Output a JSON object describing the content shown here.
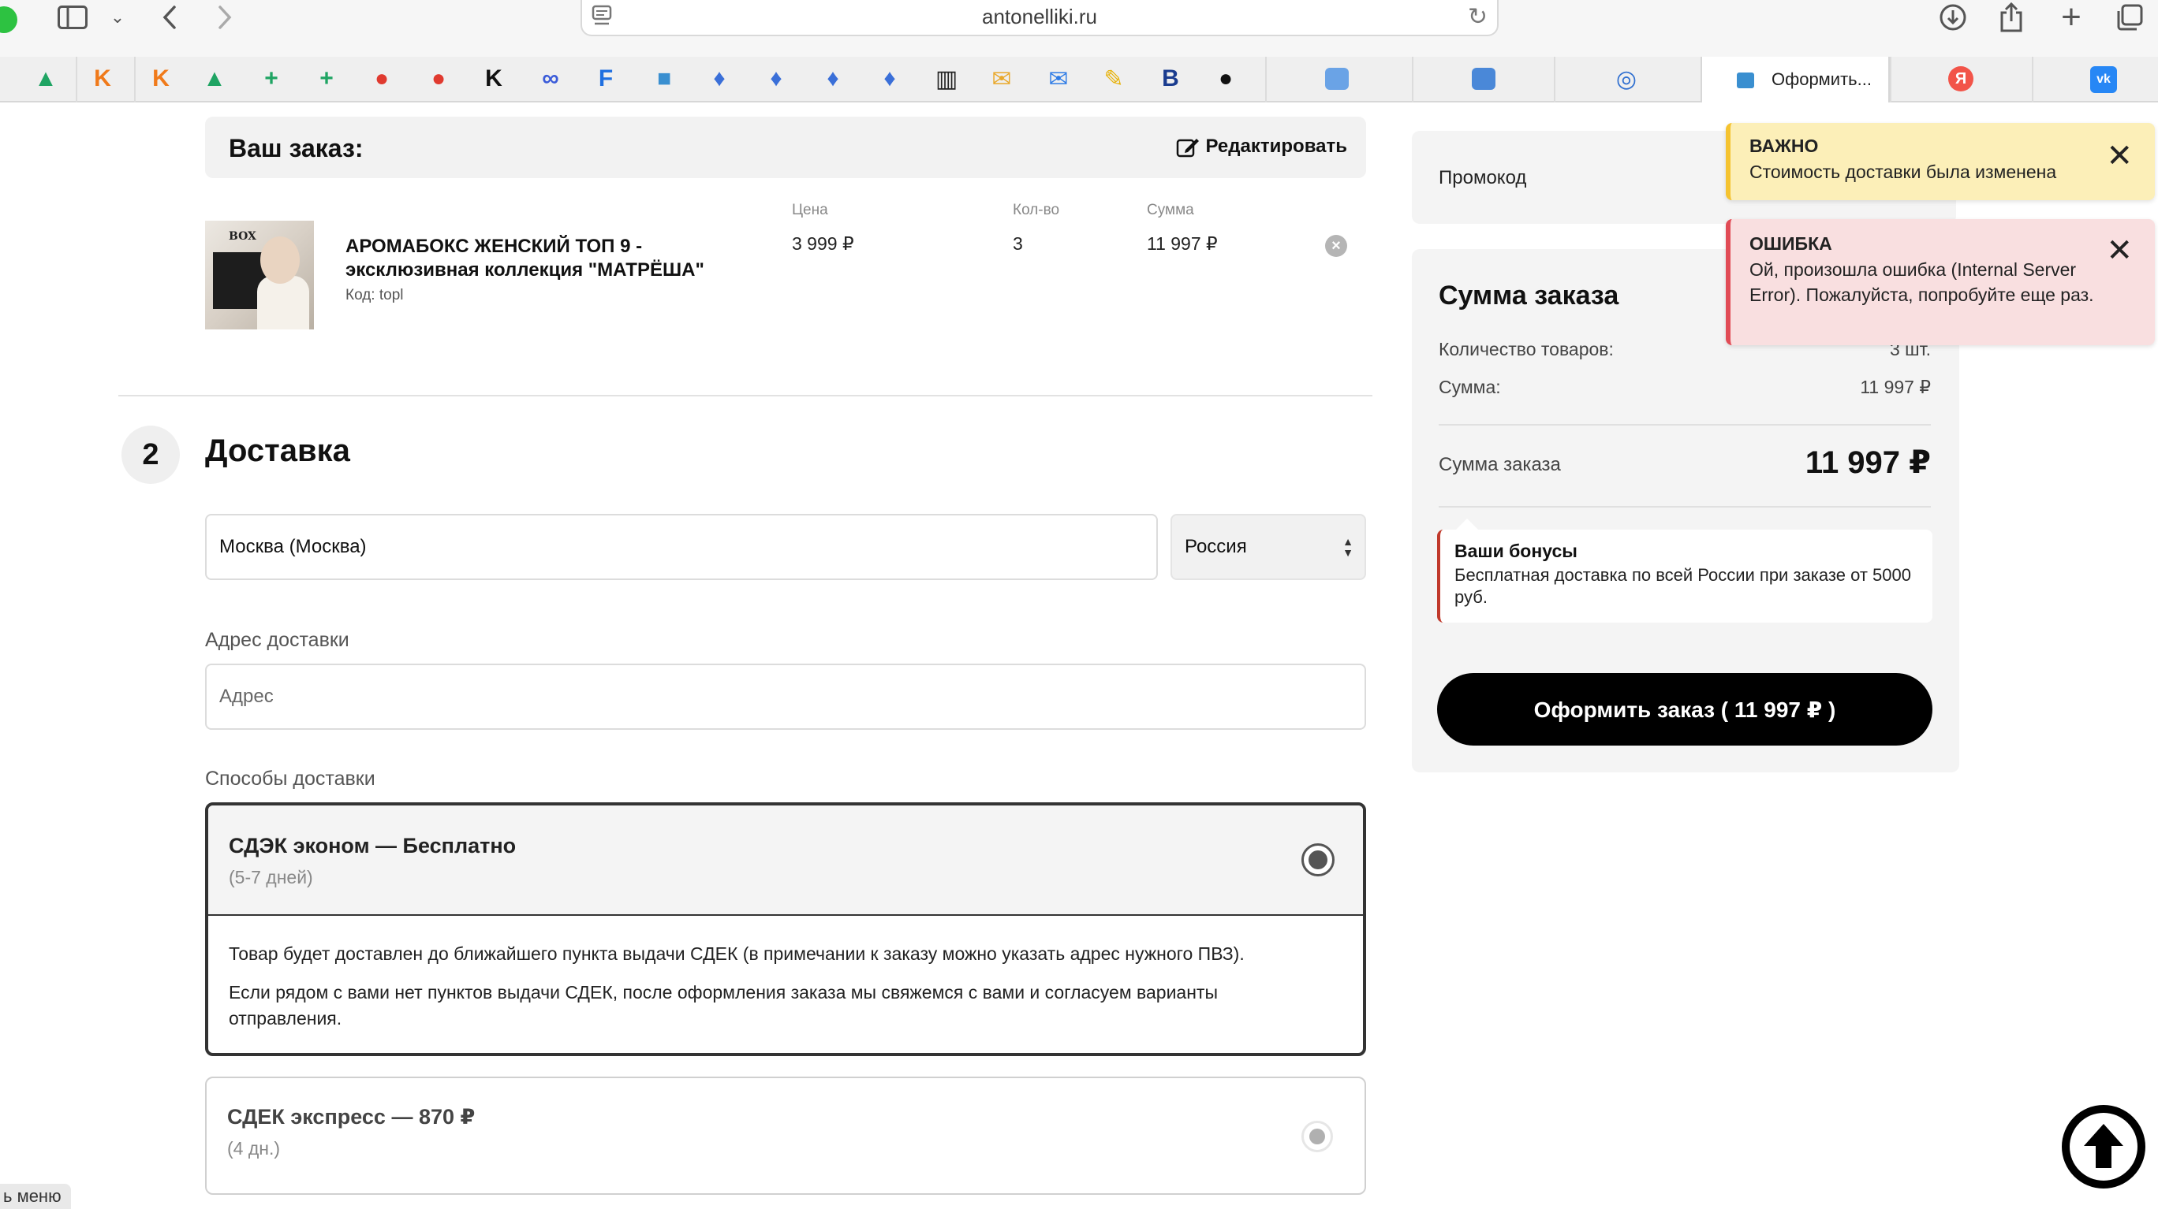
{
  "browser": {
    "url": "antonelliki.ru",
    "active_tab_label": "Оформить..."
  },
  "favorites": [
    {
      "icon": "google-drive-icon",
      "glyph": "▲",
      "color": "#1fa463"
    },
    {
      "icon": "k-orange-icon",
      "glyph": "K",
      "color": "#f07a1a"
    },
    {
      "icon": "k-orange-icon",
      "glyph": "K",
      "color": "#f07a1a"
    },
    {
      "icon": "google-drive-icon",
      "glyph": "▲",
      "color": "#1fa463"
    },
    {
      "icon": "sheets-plus-icon",
      "glyph": "+",
      "color": "#1fa463"
    },
    {
      "icon": "sheets-plus-icon",
      "glyph": "+",
      "color": "#1fa463"
    },
    {
      "icon": "red-circle-icon",
      "glyph": "●",
      "color": "#e03a2f"
    },
    {
      "icon": "red-circle-icon",
      "glyph": "●",
      "color": "#e03a2f"
    },
    {
      "icon": "k-black-icon",
      "glyph": "K",
      "color": "#111111"
    },
    {
      "icon": "blue-loop-icon",
      "glyph": "∞",
      "color": "#3a5bd9"
    },
    {
      "icon": "f-blue-icon",
      "glyph": "F",
      "color": "#1f6fe0"
    },
    {
      "icon": "blue-square-icon",
      "glyph": "■",
      "color": "#3a8fd0"
    },
    {
      "icon": "blue-drops-icon",
      "glyph": "♦",
      "color": "#3a6fd8"
    },
    {
      "icon": "blue-drops-icon",
      "glyph": "♦",
      "color": "#3a6fd8"
    },
    {
      "icon": "blue-drops-icon",
      "glyph": "♦",
      "color": "#3a6fd8"
    },
    {
      "icon": "blue-drops-icon",
      "glyph": "♦",
      "color": "#3a6fd8"
    },
    {
      "icon": "columns-icon",
      "glyph": "▥",
      "color": "#222222"
    },
    {
      "icon": "mail-envelope-icon",
      "glyph": "✉",
      "color": "#e9a82a"
    },
    {
      "icon": "mail-blue-icon",
      "glyph": "✉",
      "color": "#2d7be6"
    },
    {
      "icon": "yellow-pen-icon",
      "glyph": "✎",
      "color": "#e7b20a"
    },
    {
      "icon": "b-booking-icon",
      "glyph": "B",
      "color": "#1a3c8f"
    },
    {
      "icon": "dots-black-icon",
      "glyph": "●",
      "color": "#111111"
    }
  ],
  "order": {
    "title": "Ваш заказ:",
    "edit_label": "Редактировать",
    "product": {
      "name": "АРОМАБОКС ЖЕНСКИЙ ТОП 9 - эксклюзивная коллекция \"МАТРЁША\"",
      "code": "Код: topl",
      "image_caption": "BOX"
    },
    "columns": {
      "price_label": "Цена",
      "qty_label": "Кол-во",
      "sum_label": "Сумма",
      "price": "3 999 ₽",
      "qty": "3",
      "sum": "11 997 ₽"
    }
  },
  "delivery": {
    "step_number": "2",
    "title": "Доставка",
    "city": "Москва (Москва)",
    "country": "Россия",
    "address_label": "Адрес доставки",
    "address_placeholder": "Адрес",
    "methods_label": "Способы доставки",
    "methods": [
      {
        "title": "СДЭК эконом — Бесплатно",
        "subtitle": "(5-7 дней)",
        "selected": true,
        "description": [
          "Товар будет доставлен до ближайшего пункта выдачи СДЕК (в примечании к заказу можно указать адрес нужного ПВЗ).",
          "Если рядом с вами нет пунктов выдачи СДЕК, после оформления заказа мы свяжемся с вами и согласуем варианты отправления."
        ]
      },
      {
        "title": "СДЕК экспресс — 870 ₽",
        "subtitle": "(4 дн.)",
        "selected": false
      }
    ]
  },
  "sidebar": {
    "promo_label": "Промокод",
    "summary_title": "Сумма заказа",
    "items_count_label": "Количество товаров:",
    "items_count_value": "3 шт.",
    "sum_label": "Сумма:",
    "sum_value": "11 997 ₽",
    "total_label": "Сумма заказа",
    "total_value": "11 997 ₽",
    "bonus_title": "Ваши бонусы",
    "bonus_text": "Бесплатная доставка по всей России при заказе от 5000 руб.",
    "submit_label": "Оформить заказ ( 11 997 ₽ )"
  },
  "toasts": {
    "warning": {
      "title": "ВАЖНО",
      "text": "Стоимость доставки была изменена"
    },
    "error": {
      "title": "ОШИБКА",
      "text": "Ой, произошла ошибка (Internal Server Error). Пожалуйста, попробуйте еще раз."
    }
  },
  "menu_tab_label": "ь меню"
}
